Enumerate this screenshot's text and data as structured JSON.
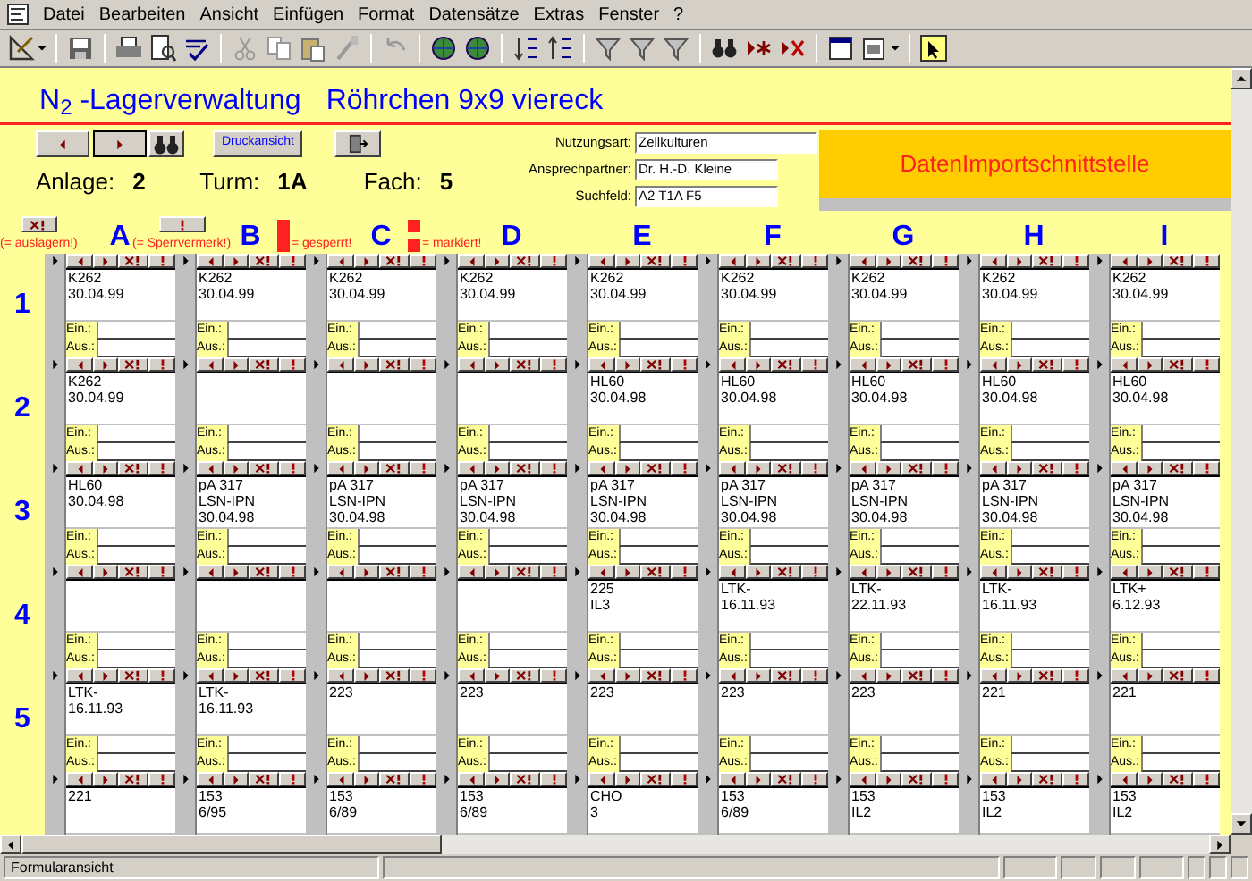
{
  "menu_bar": {
    "items": [
      "Datei",
      "Bearbeiten",
      "Ansicht",
      "Einfügen",
      "Format",
      "Datensätze",
      "Extras",
      "Fenster",
      "?"
    ]
  },
  "form": {
    "title": "N$_{2}$ -Lagerverwaltung",
    "subtitle": "Röhrchen 9x9 viereck",
    "print_button": "Druckansicht",
    "location": [
      {
        "label": "Anlage:",
        "value": "2"
      },
      {
        "label": "Turm:",
        "value": "1A"
      },
      {
        "label": "Fach:",
        "value": "5"
      }
    ],
    "fields": [
      {
        "label": "Nutzungsart:",
        "value": "Zellkulturen"
      },
      {
        "label": "Ansprechpartner:",
        "value": "Dr. H.-D. Kleine"
      },
      {
        "label": "Suchfeld:",
        "value": "A2 T1A F5"
      }
    ],
    "import_panel": "DatenImportschnittstelle",
    "legend": [
      {
        "kind": "remove",
        "text": "(= auslagern!)"
      },
      {
        "kind": "note",
        "text": "(= Sperrvermerk!)"
      },
      {
        "kind": "bar",
        "text": "= gesperrt!"
      },
      {
        "kind": "split",
        "text": "= markiert!"
      }
    ],
    "columns": [
      "A",
      "B",
      "C",
      "D",
      "E",
      "F",
      "G",
      "H",
      "I"
    ],
    "rows": [
      {
        "label": "1",
        "cells": [
          {
            "lines": [
              "K262",
              "30.04.99"
            ],
            "in_label": "Ein.:",
            "out_label": "Aus.:"
          },
          {
            "lines": [
              "K262",
              "30.04.99"
            ],
            "in_label": "Ein.:",
            "out_label": "Aus.:"
          },
          {
            "lines": [
              "K262",
              "30.04.99"
            ],
            "in_label": "Ein.:",
            "out_label": "Aus.:"
          },
          {
            "lines": [
              "K262",
              "30.04.99"
            ],
            "in_label": "Ein.:",
            "out_label": "Aus.:"
          },
          {
            "lines": [
              "K262",
              "30.04.99"
            ],
            "in_label": "Ein.:",
            "out_label": "Aus.:"
          },
          {
            "lines": [
              "K262",
              "30.04.99"
            ],
            "in_label": "Ein.:",
            "out_label": "Aus.:"
          },
          {
            "lines": [
              "K262",
              "30.04.99"
            ],
            "in_label": "Ein.:",
            "out_label": "Aus.:"
          },
          {
            "lines": [
              "K262",
              "30.04.99"
            ],
            "in_label": "Ein.:",
            "out_label": "Aus.:"
          },
          {
            "lines": [
              "K262",
              "30.04.99"
            ],
            "in_label": "Ein.:",
            "out_label": "Aus.:"
          }
        ]
      },
      {
        "label": "2",
        "cells": [
          {
            "lines": [
              "K262",
              "30.04.99"
            ],
            "in_label": "Ein.:",
            "out_label": "Aus.:"
          },
          {
            "in_label": "Ein.:",
            "out_label": "Aus.:"
          },
          {
            "in_label": "Ein.:",
            "out_label": "Aus.:"
          },
          {
            "in_label": "Ein.:",
            "out_label": "Aus.:"
          },
          {
            "lines": [
              "HL60",
              "30.04.98"
            ],
            "in_label": "Ein.:",
            "out_label": "Aus.:"
          },
          {
            "lines": [
              "HL60",
              "30.04.98"
            ],
            "in_label": "Ein.:",
            "out_label": "Aus.:"
          },
          {
            "lines": [
              "HL60",
              "30.04.98"
            ],
            "in_label": "Ein.:",
            "out_label": "Aus.:"
          },
          {
            "lines": [
              "HL60",
              "30.04.98"
            ],
            "in_label": "Ein.:",
            "out_label": "Aus.:"
          },
          {
            "lines": [
              "HL60",
              "30.04.98"
            ],
            "in_label": "Ein.:",
            "out_label": "Aus.:"
          }
        ]
      },
      {
        "label": "3",
        "cells": [
          {
            "lines": [
              "HL60",
              "30.04.98"
            ],
            "in_label": "Ein.:",
            "out_label": "Aus.:"
          },
          {
            "lines": [
              "pA 317",
              "LSN-IPN",
              "30.04.98"
            ],
            "in_label": "Ein.:",
            "out_label": "Aus.:"
          },
          {
            "lines": [
              "pA 317",
              "LSN-IPN",
              "30.04.98"
            ],
            "in_label": "Ein.:",
            "out_label": "Aus.:"
          },
          {
            "lines": [
              "pA 317",
              "LSN-IPN",
              "30.04.98"
            ],
            "in_label": "Ein.:",
            "out_label": "Aus.:"
          },
          {
            "lines": [
              "pA 317",
              "LSN-IPN",
              "30.04.98"
            ],
            "in_label": "Ein.:",
            "out_label": "Aus.:"
          },
          {
            "lines": [
              "pA 317",
              "LSN-IPN",
              "30.04.98"
            ],
            "in_label": "Ein.:",
            "out_label": "Aus.:"
          },
          {
            "lines": [
              "pA 317",
              "LSN-IPN",
              "30.04.98"
            ],
            "in_label": "Ein.:",
            "out_label": "Aus.:"
          },
          {
            "lines": [
              "pA 317",
              "LSN-IPN",
              "30.04.98"
            ],
            "in_label": "Ein.:",
            "out_label": "Aus.:"
          },
          {
            "lines": [
              "pA 317",
              "LSN-IPN",
              "30.04.98"
            ],
            "in_label": "Ein.:",
            "out_label": "Aus.:"
          }
        ]
      },
      {
        "label": "4",
        "cells": [
          {
            "in_label": "Ein.:",
            "out_label": "Aus.:"
          },
          {
            "in_label": "Ein.:",
            "out_label": "Aus.:"
          },
          {
            "in_label": "Ein.:",
            "out_label": "Aus.:"
          },
          {
            "in_label": "Ein.:",
            "out_label": "Aus.:"
          },
          {
            "lines": [
              "225",
              "IL3"
            ],
            "in_label": "Ein.:",
            "out_label": "Aus.:"
          },
          {
            "lines": [
              "LTK-",
              "16.11.93"
            ],
            "in_label": "Ein.:",
            "out_label": "Aus.:"
          },
          {
            "lines": [
              "LTK-",
              "22.11.93"
            ],
            "in_label": "Ein.:",
            "out_label": "Aus.:"
          },
          {
            "lines": [
              "LTK-",
              "16.11.93"
            ],
            "in_label": "Ein.:",
            "out_label": "Aus.:"
          },
          {
            "lines": [
              "LTK+",
              "6.12.93"
            ],
            "in_label": "Ein.:",
            "out_label": "Aus.:"
          }
        ]
      },
      {
        "label": "5",
        "cells": [
          {
            "lines": [
              "LTK-",
              "16.11.93"
            ],
            "in_label": "Ein.:",
            "out_label": "Aus.:"
          },
          {
            "lines": [
              "LTK-",
              "16.11.93"
            ],
            "in_label": "Ein.:",
            "out_label": "Aus.:"
          },
          {
            "lines": [
              "223"
            ],
            "in_label": "Ein.:",
            "out_label": "Aus.:"
          },
          {
            "lines": [
              "223"
            ],
            "in_label": "Ein.:",
            "out_label": "Aus.:"
          },
          {
            "lines": [
              "223"
            ],
            "in_label": "Ein.:",
            "out_label": "Aus.:"
          },
          {
            "lines": [
              "223"
            ],
            "in_label": "Ein.:",
            "out_label": "Aus.:"
          },
          {
            "lines": [
              "223"
            ],
            "in_label": "Ein.:",
            "out_label": "Aus.:"
          },
          {
            "lines": [
              "221"
            ],
            "in_label": "Ein.:",
            "out_label": "Aus.:"
          },
          {
            "lines": [
              "221"
            ],
            "in_label": "Ein.:",
            "out_label": "Aus.:"
          }
        ]
      },
      {
        "cells": [
          {
            "lines": [
              "221"
            ]
          },
          {
            "lines": [
              "153",
              "6/95"
            ]
          },
          {
            "lines": [
              "153",
              "6/89"
            ]
          },
          {
            "lines": [
              "153",
              "6/89"
            ]
          },
          {
            "lines": [
              "CHO",
              "3"
            ]
          },
          {
            "lines": [
              "153",
              "6/89"
            ]
          },
          {
            "lines": [
              "153",
              "IL2"
            ]
          },
          {
            "lines": [
              "153",
              "IL2"
            ]
          },
          {
            "lines": [
              "153",
              "IL2"
            ]
          }
        ]
      }
    ]
  },
  "status_bar": {
    "text": "Formularansicht"
  }
}
